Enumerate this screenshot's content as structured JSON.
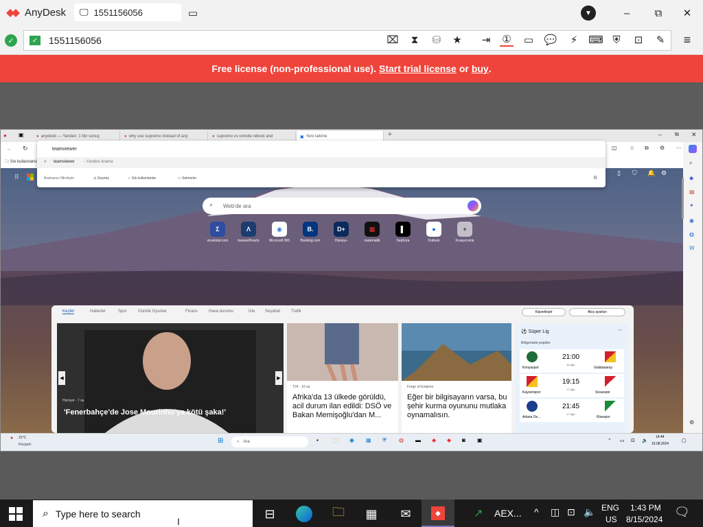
{
  "anydesk": {
    "app_name": "AnyDesk",
    "session_tab": "1551156056",
    "address": "1551156056",
    "banner_prefix": "Free license (non-professional use).",
    "banner_link1": "Start trial license",
    "banner_or": "or",
    "banner_link2": "buy",
    "banner_dot": "."
  },
  "remote": {
    "tabs": [
      "anydesk — Yandex: 1 bin sonuç",
      "why use supremo instead of any",
      "supremo vs remote reboot and",
      "Yeni sekme"
    ],
    "fav_label": "Sık kullanılanlar",
    "search_value": "teamviewer",
    "suggestion": "teamviewer",
    "suggestion_suffix": "- Yandex Arama",
    "dropdown_actions": [
      "Aramanızı filtreleyin",
      "Geçmiş",
      "Sık kullanılanlar",
      "Sekmeler"
    ],
    "newtab_search_placeholder": "Web'de ara",
    "shortcuts": [
      "virustotal.com",
      "baraxel/hourly",
      "Microsoft 365",
      "Booking.com",
      "Disney+",
      "matematik",
      "Sephora",
      "Outlook",
      "Kısayol ekle"
    ],
    "feed_tabs": [
      "Keşfet",
      "Haberler",
      "Spor",
      "Günlük Oyunlar",
      "Finans",
      "Hava durumu",
      "İzle",
      "Seyahat",
      "Trafik"
    ],
    "personalize_btn": "Kişiselleştir",
    "feed_settings_btn": "Akış ayarları",
    "card1": {
      "source": "Hürriyet · 7 sa",
      "title": "'Fenerbahçe'de Jose Mourinho'ya kötü şaka!'"
    },
    "card2": {
      "source": "T24 · 16 sa",
      "title": "Afrika'da 13 ülkede görüldü, acil durum ilan edildi: DSÖ ve Bakan Memişoğlu'dan M..."
    },
    "card3": {
      "source": "Forge of Empires",
      "title": "Eğer bir bilgisayarın varsa, bu şehir kurma oyununu mutlaka oynamalısın."
    },
    "league": {
      "title": "Süper Lig",
      "subtitle": "Bölgenizde popüler",
      "matches": [
        {
          "home": "Konyaspor",
          "time": "21:00",
          "date": "16 Ağu",
          "away": "Galatasaray"
        },
        {
          "home": "Kayserispor",
          "time": "19:15",
          "date": "17 Ağu",
          "away": "Sivasspor"
        },
        {
          "home": "Adana De...",
          "time": "21:45",
          "date": "17 Ağu",
          "away": "Rizespor"
        }
      ]
    },
    "taskbar": {
      "weather_temp": "31°C",
      "weather_desc": "Rüzgarlı",
      "search": "Ara",
      "time": "14:44",
      "date": "15.08.2024"
    }
  },
  "windows": {
    "search_placeholder": "Type here to search",
    "stock": "AEX...",
    "lang1": "ENG",
    "lang2": "US",
    "time": "1:43 PM",
    "date": "8/15/2024"
  }
}
